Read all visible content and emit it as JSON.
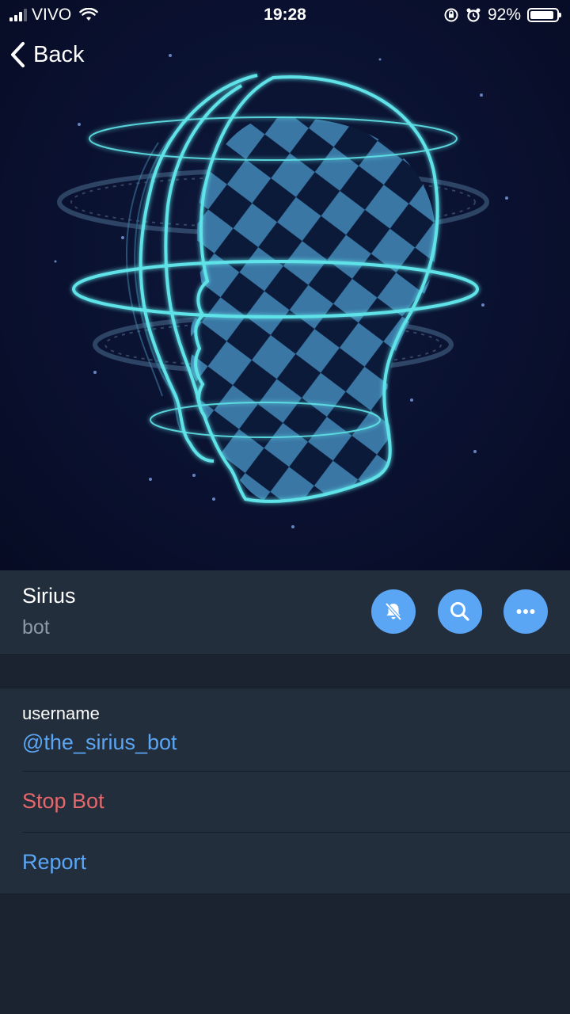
{
  "status_bar": {
    "carrier": "VIVO",
    "time": "19:28",
    "battery_percent": "92%",
    "battery_level": 0.92
  },
  "nav": {
    "back_label": "Back"
  },
  "profile": {
    "name": "Sirius",
    "type": "bot",
    "actions": [
      {
        "name": "mute-button",
        "icon": "bell-slash-icon"
      },
      {
        "name": "search-button",
        "icon": "search-icon"
      },
      {
        "name": "more-button",
        "icon": "more-dots-icon"
      }
    ]
  },
  "info": {
    "username_label": "username",
    "username_value": "@the_sirius_bot",
    "stop_bot_label": "Stop Bot",
    "report_label": "Report"
  },
  "colors": {
    "accent": "#5aa6f5",
    "danger": "#e5686a",
    "panel": "#232e3d",
    "background": "#1b2330",
    "hero_background": "#0a1130",
    "hero_glow": "#5fe3e8"
  }
}
